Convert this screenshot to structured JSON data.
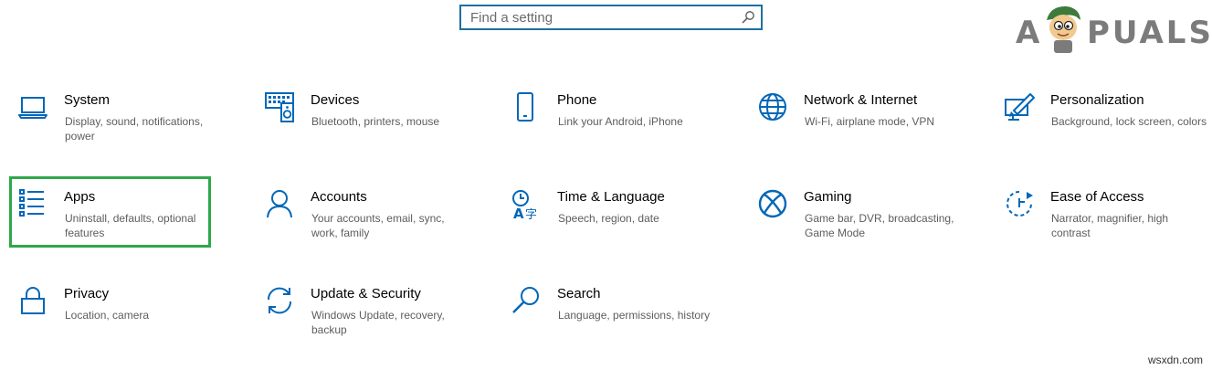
{
  "search": {
    "placeholder": "Find a setting"
  },
  "logo": {
    "text_left": "A",
    "text_right": "PUALS"
  },
  "accent_color": "#0067b8",
  "selection_color": "#2ea84a",
  "tiles": [
    {
      "title": "System",
      "desc": "Display, sound, notifications, power",
      "icon": "laptop-icon"
    },
    {
      "title": "Devices",
      "desc": "Bluetooth, printers, mouse",
      "icon": "keyboard-speaker-icon"
    },
    {
      "title": "Phone",
      "desc": "Link your Android, iPhone",
      "icon": "phone-icon"
    },
    {
      "title": "Network & Internet",
      "desc": "Wi-Fi, airplane mode, VPN",
      "icon": "globe-icon"
    },
    {
      "title": "Personalization",
      "desc": "Background, lock screen, colors",
      "icon": "paint-brush-icon"
    },
    {
      "title": "Apps",
      "desc": "Uninstall, defaults, optional features",
      "icon": "apps-list-icon"
    },
    {
      "title": "Accounts",
      "desc": "Your accounts, email, sync, work, family",
      "icon": "person-icon"
    },
    {
      "title": "Time & Language",
      "desc": "Speech, region, date",
      "icon": "time-language-icon"
    },
    {
      "title": "Gaming",
      "desc": "Game bar, DVR, broadcasting, Game Mode",
      "icon": "xbox-icon"
    },
    {
      "title": "Ease of Access",
      "desc": "Narrator, magnifier, high contrast",
      "icon": "ease-of-access-icon"
    },
    {
      "title": "Privacy",
      "desc": "Location, camera",
      "icon": "lock-icon"
    },
    {
      "title": "Update & Security",
      "desc": "Windows Update, recovery, backup",
      "icon": "sync-arrows-icon"
    },
    {
      "title": "Search",
      "desc": "Language, permissions, history",
      "icon": "magnifier-icon"
    }
  ],
  "watermark": "wsxdn.com"
}
